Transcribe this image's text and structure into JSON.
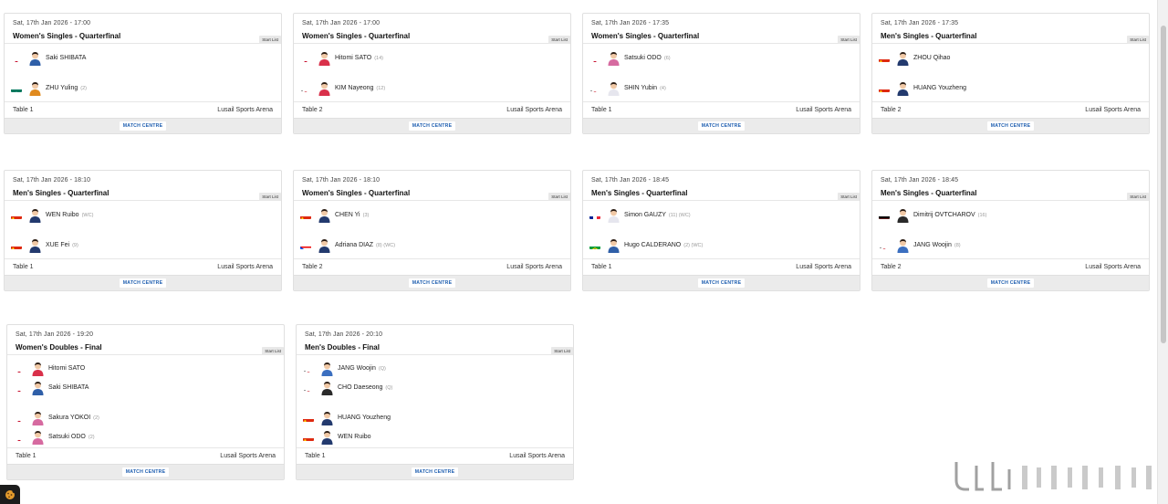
{
  "labels": {
    "start_list": "Start List",
    "match_centre": "MATCH CENTRE"
  },
  "colors": {
    "accent": "#1f5fb0",
    "card_bar": "#ebebeb"
  },
  "icons": {
    "cookie": "cookie-icon",
    "avatar": "player-avatar-icon",
    "scroll": "scrollbar"
  },
  "matches": [
    {
      "date": "Sat, 17th Jan 2026 - 17:00",
      "title": "Women's Singles - Quarterfinal",
      "table": "Table 1",
      "venue": "Lusail Sports Arena",
      "players": [
        {
          "name": "Saki SHIBATA",
          "seed": "",
          "flag": "JPN",
          "shirt": "#2f5fa8"
        },
        {
          "name": "ZHU Yuling",
          "seed": "(2)",
          "flag": "MAC",
          "shirt": "#e08a1e"
        }
      ]
    },
    {
      "date": "Sat, 17th Jan 2026 - 17:00",
      "title": "Women's Singles - Quarterfinal",
      "table": "Table 2",
      "venue": "Lusail Sports Arena",
      "players": [
        {
          "name": "Hitomi SATO",
          "seed": "(14)",
          "flag": "JPN",
          "shirt": "#d9304a"
        },
        {
          "name": "KIM Nayeong",
          "seed": "(12)",
          "flag": "KOR",
          "shirt": "#d9304a"
        }
      ]
    },
    {
      "date": "Sat, 17th Jan 2026 - 17:35",
      "title": "Women's Singles - Quarterfinal",
      "table": "Table 1",
      "venue": "Lusail Sports Arena",
      "players": [
        {
          "name": "Satsuki ODO",
          "seed": "(6)",
          "flag": "JPN",
          "shirt": "#d66aa0"
        },
        {
          "name": "SHIN Yubin",
          "seed": "(4)",
          "flag": "KOR",
          "shirt": "#e6e6ee"
        }
      ]
    },
    {
      "date": "Sat, 17th Jan 2026 - 17:35",
      "title": "Men's Singles - Quarterfinal",
      "table": "Table 2",
      "venue": "Lusail Sports Arena",
      "players": [
        {
          "name": "ZHOU Qihao",
          "seed": "",
          "flag": "CHN",
          "shirt": "#233a6e"
        },
        {
          "name": "HUANG Youzheng",
          "seed": "",
          "flag": "CHN",
          "shirt": "#233a6e"
        }
      ]
    },
    {
      "date": "Sat, 17th Jan 2026 - 18:10",
      "title": "Men's Singles - Quarterfinal",
      "table": "Table 1",
      "venue": "Lusail Sports Arena",
      "players": [
        {
          "name": "WEN Ruibo",
          "seed": "(WC)",
          "flag": "CHN",
          "shirt": "#233a6e"
        },
        {
          "name": "XUE Fei",
          "seed": "(9)",
          "flag": "CHN",
          "shirt": "#233a6e"
        }
      ]
    },
    {
      "date": "Sat, 17th Jan 2026 - 18:10",
      "title": "Women's Singles - Quarterfinal",
      "table": "Table 2",
      "venue": "Lusail Sports Arena",
      "players": [
        {
          "name": "CHEN Yi",
          "seed": "(3)",
          "flag": "CHN",
          "shirt": "#233a6e"
        },
        {
          "name": "Adriana DIAZ",
          "seed": "(8)  (WC)",
          "flag": "PUR",
          "shirt": "#233a6e"
        }
      ]
    },
    {
      "date": "Sat, 17th Jan 2026 - 18:45",
      "title": "Men's Singles - Quarterfinal",
      "table": "Table 1",
      "venue": "Lusail Sports Arena",
      "players": [
        {
          "name": "Simon GAUZY",
          "seed": "(11)  (WC)",
          "flag": "FRA",
          "shirt": "#e6e6ee"
        },
        {
          "name": "Hugo CALDERANO",
          "seed": "(2)  (WC)",
          "flag": "BRA",
          "shirt": "#2f5fa8"
        }
      ]
    },
    {
      "date": "Sat, 17th Jan 2026 - 18:45",
      "title": "Men's Singles - Quarterfinal",
      "table": "Table 2",
      "venue": "Lusail Sports Arena",
      "players": [
        {
          "name": "Dimitrij OVTCHAROV",
          "seed": "(16)",
          "flag": "GER",
          "shirt": "#2a2a2a"
        },
        {
          "name": "JANG Woojin",
          "seed": "(8)",
          "flag": "KOR",
          "shirt": "#3b6fc0"
        }
      ]
    },
    {
      "date": "Sat, 17th Jan 2026 - 19:20",
      "title": "Women's Doubles - Final",
      "table": "Table 1",
      "venue": "Lusail Sports Arena",
      "players": [
        {
          "name": "Hitomi SATO",
          "seed": "",
          "flag": "JPN",
          "shirt": "#d9304a"
        },
        {
          "name": "Saki SHIBATA",
          "seed": "",
          "flag": "JPN",
          "shirt": "#2f5fa8"
        },
        {
          "name": "Sakura YOKOI",
          "seed": "(2)",
          "flag": "JPN",
          "shirt": "#d66aa0"
        },
        {
          "name": "Satsuki ODO",
          "seed": "(2)",
          "flag": "JPN",
          "shirt": "#d66aa0"
        }
      ]
    },
    {
      "date": "Sat, 17th Jan 2026 - 20:10",
      "title": "Men's Doubles - Final",
      "table": "Table 1",
      "venue": "Lusail Sports Arena",
      "players": [
        {
          "name": "JANG Woojin",
          "seed": "(Q)",
          "flag": "KOR",
          "shirt": "#3b6fc0"
        },
        {
          "name": "CHO Daeseong",
          "seed": "(Q)",
          "flag": "KOR",
          "shirt": "#2a2a2a"
        },
        {
          "name": "HUANG Youzheng",
          "seed": "",
          "flag": "CHN",
          "shirt": "#233a6e"
        },
        {
          "name": "WEN Ruibo",
          "seed": "",
          "flag": "CHN",
          "shirt": "#233a6e"
        }
      ]
    }
  ]
}
